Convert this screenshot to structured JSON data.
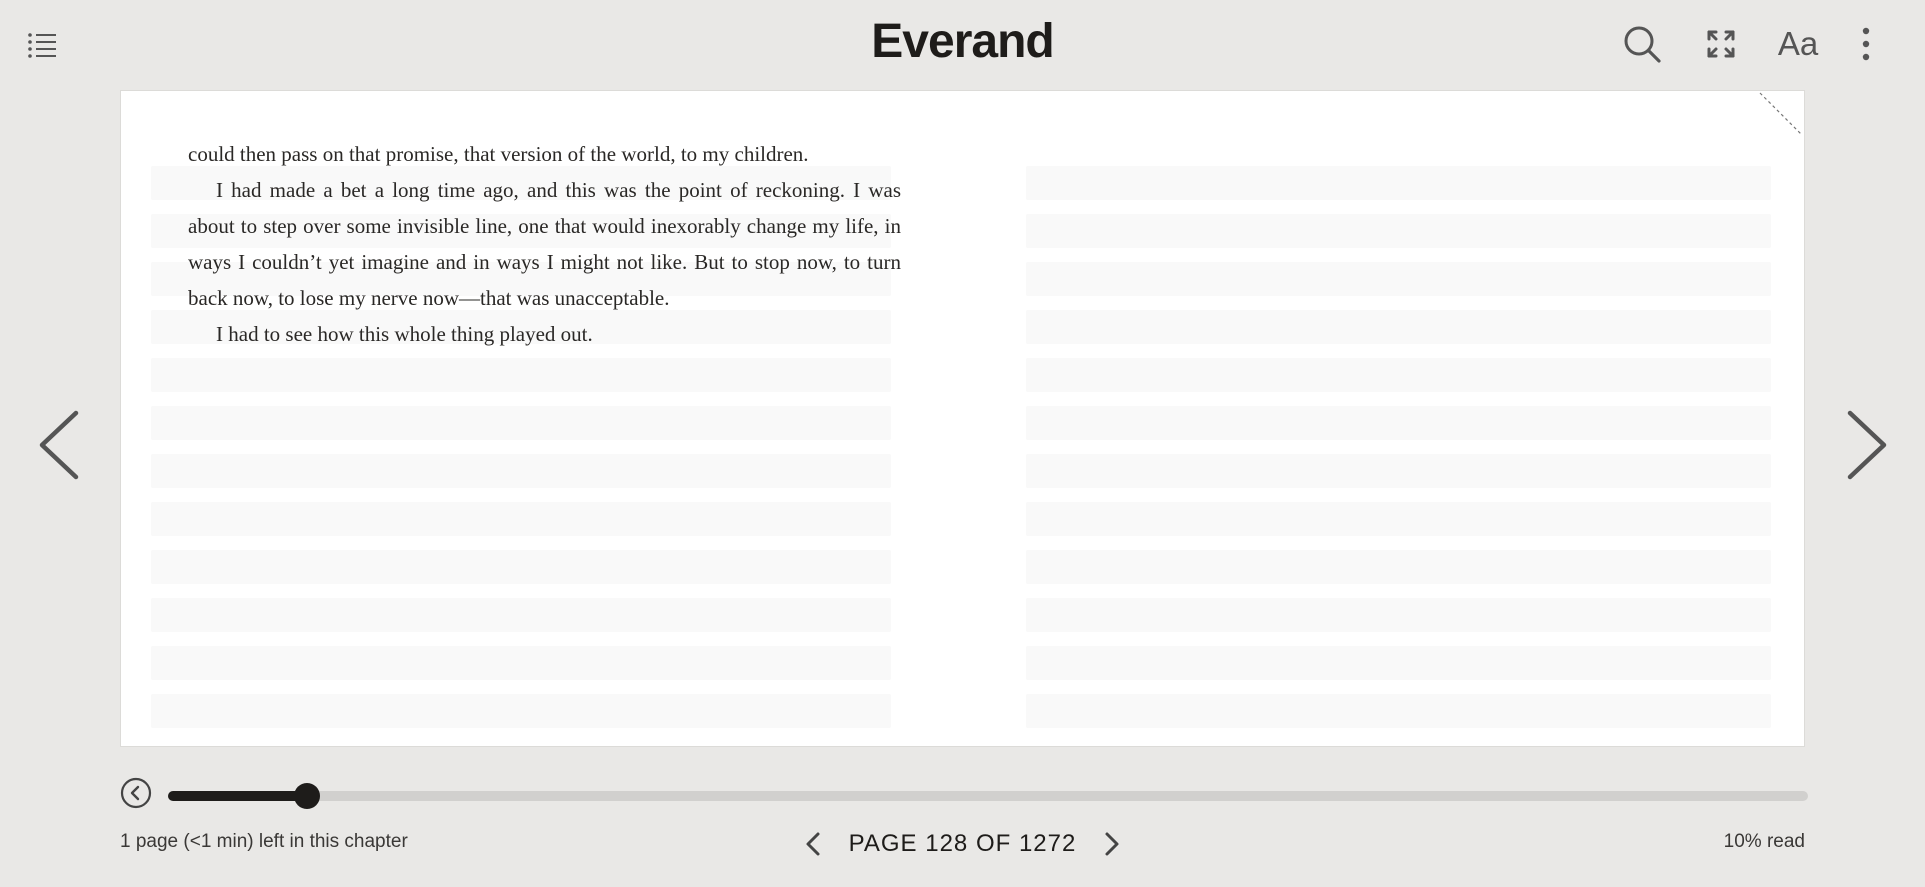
{
  "header": {
    "brand": "Everand",
    "icons": {
      "toc": "list-icon",
      "search": "search-icon",
      "fullscreen": "expand-icon",
      "font_settings_label": "Aa",
      "more": "more-vertical-icon"
    }
  },
  "reader": {
    "paragraphs": [
      "could then pass on that promise, that version of the world, to my children.",
      "I had made a bet a long time ago, and this was the point of reckoning. I was about to step over some invisible line, one that would inexorably change my life, in ways I couldn’t yet imagine and in ways I might not like. But to stop now, to turn back now, to lose my nerve now—that was unacceptable.",
      "I had to see how this whole thing played out."
    ]
  },
  "progress": {
    "fraction": 0.085
  },
  "footer": {
    "chapter_remaining": "1 page (<1 min) left in this chapter",
    "page_label": "PAGE 128 OF 1272",
    "read_percent": "10% read"
  },
  "colors": {
    "background": "#e9e8e6",
    "page": "#ffffff",
    "text": "#1e1c1a",
    "track": "#d1d0ce"
  }
}
